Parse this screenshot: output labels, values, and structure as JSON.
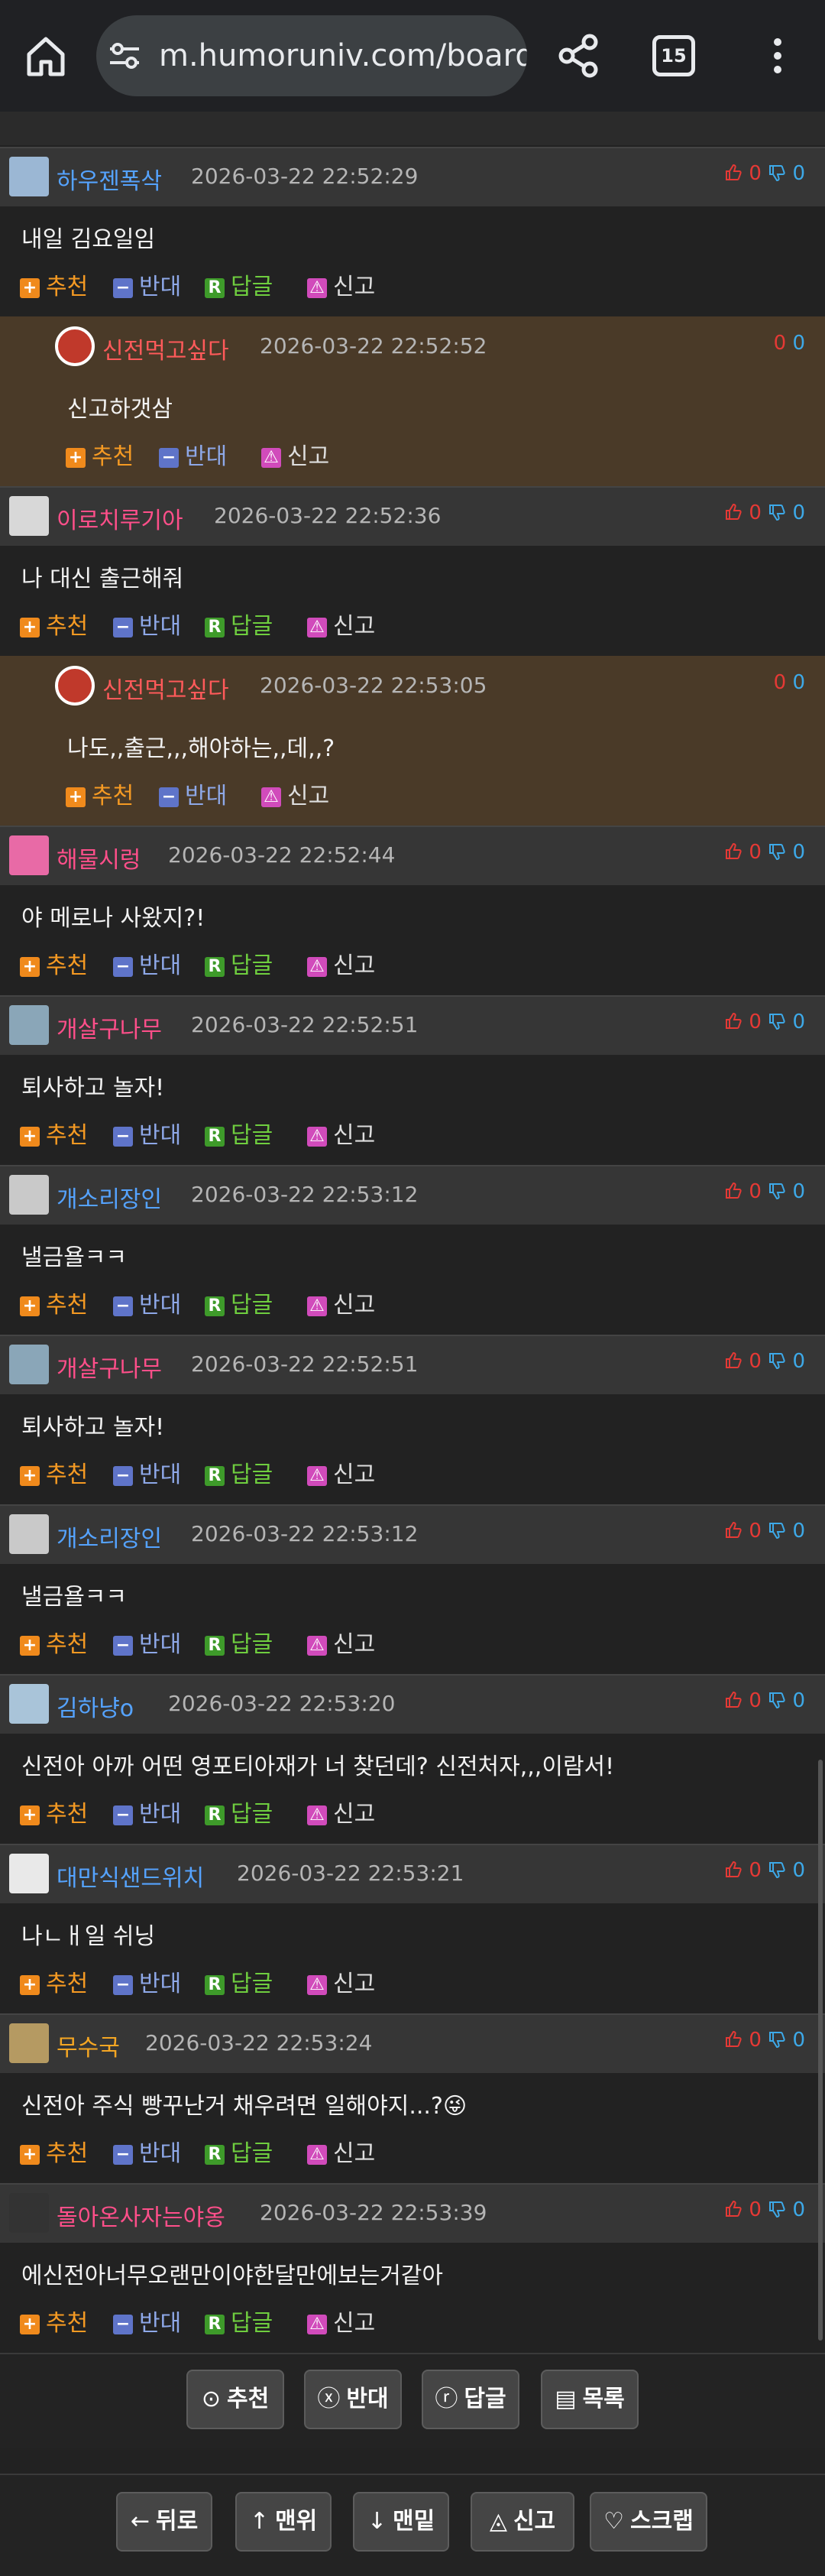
{
  "browser": {
    "url": "m.humoruniv.com/board/read",
    "tab_count": "15",
    "icons": [
      "home-icon",
      "tune-icon",
      "share-icon",
      "tabs-icon",
      "more-vert-icon"
    ]
  },
  "actions": {
    "recommend": "추천",
    "oppose": "반대",
    "reply": "답글",
    "report": "신고"
  },
  "comments": [
    {
      "nick": "하우젠폭삭",
      "nick_color": "#55a3ff",
      "date": "2026-03-22 22:52:29",
      "up": "0",
      "down": "0",
      "text": "내일 김요일임",
      "reply": false
    },
    {
      "nick": "신전먹고싶다",
      "nick_color": "#ff5a5a",
      "date": "2026-03-22 22:52:52",
      "up": "0",
      "down": "0",
      "text": "신고하갯삼",
      "reply": true
    },
    {
      "nick": "이로치루기아",
      "nick_color": "#ff4f8a",
      "date": "2026-03-22 22:52:36",
      "up": "0",
      "down": "0",
      "text": "나 대신 출근해줘",
      "reply": false
    },
    {
      "nick": "신전먹고싶다",
      "nick_color": "#ff5a5a",
      "date": "2026-03-22 22:53:05",
      "up": "0",
      "down": "0",
      "text": "나도,,출근,,,해야하는,,데,,?",
      "reply": true
    },
    {
      "nick": "해물시렁",
      "nick_color": "#ff4f8a",
      "date": "2026-03-22 22:52:44",
      "up": "0",
      "down": "0",
      "text": "야 메로나 사왔지?!",
      "reply": false
    },
    {
      "nick": "개살구나무",
      "nick_color": "#ff4f8a",
      "date": "2026-03-22 22:52:51",
      "up": "0",
      "down": "0",
      "text": "퇴사하고 놀자!",
      "reply": false
    },
    {
      "nick": "개소리장인",
      "nick_color": "#55a3ff",
      "date": "2026-03-22 22:53:12",
      "up": "0",
      "down": "0",
      "text": "낼금욜ㅋㅋ",
      "reply": false
    },
    {
      "nick": "개살구나무",
      "nick_color": "#ff4f8a",
      "date": "2026-03-22 22:52:51",
      "up": "0",
      "down": "0",
      "text": "퇴사하고 놀자!",
      "reply": false
    },
    {
      "nick": "개소리장인",
      "nick_color": "#55a3ff",
      "date": "2026-03-22 22:53:12",
      "up": "0",
      "down": "0",
      "text": "낼금욜ㅋㅋ",
      "reply": false
    },
    {
      "nick": "김하냥o",
      "nick_color": "#55a3ff",
      "date": "2026-03-22 22:53:20",
      "up": "0",
      "down": "0",
      "text": "신전아 아까 어떤 영포티아재가 너 찾던데? 신전처자,,,이람서!",
      "reply": false
    },
    {
      "nick": "대만식샌드위치",
      "nick_color": "#55a3ff",
      "date": "2026-03-22 22:53:21",
      "up": "0",
      "down": "0",
      "text": "나ㄴㅐ일 쉬닝",
      "reply": false
    },
    {
      "nick": "무수국",
      "nick_color": "#f5a623",
      "date": "2026-03-22 22:53:24",
      "up": "0",
      "down": "0",
      "text": "신전아 주식 빵꾸난거 채우려면 일해야지...?😜",
      "reply": false
    },
    {
      "nick": "돌아온사자는야옹",
      "nick_color": "#ff4f8a",
      "date": "2026-03-22 22:53:39",
      "up": "0",
      "down": "0",
      "text": "에신전아너무오랜만이야한달만에보는거같아",
      "reply": false
    }
  ],
  "bottom_actions_1": [
    {
      "label": "추천",
      "icon": "recommend-circle-icon"
    },
    {
      "label": "반대",
      "icon": "oppose-circle-icon"
    },
    {
      "label": "답글",
      "icon": "reply-circle-icon"
    },
    {
      "label": "목록",
      "icon": "list-icon"
    }
  ],
  "bottom_actions_2": [
    {
      "label": "뒤로",
      "icon": "arrow-left-icon"
    },
    {
      "label": "맨위",
      "icon": "arrow-up-icon"
    },
    {
      "label": "맨밑",
      "icon": "arrow-down-icon"
    },
    {
      "label": "신고",
      "icon": "report-icon"
    },
    {
      "label": "스크랩",
      "icon": "heart-icon"
    }
  ]
}
